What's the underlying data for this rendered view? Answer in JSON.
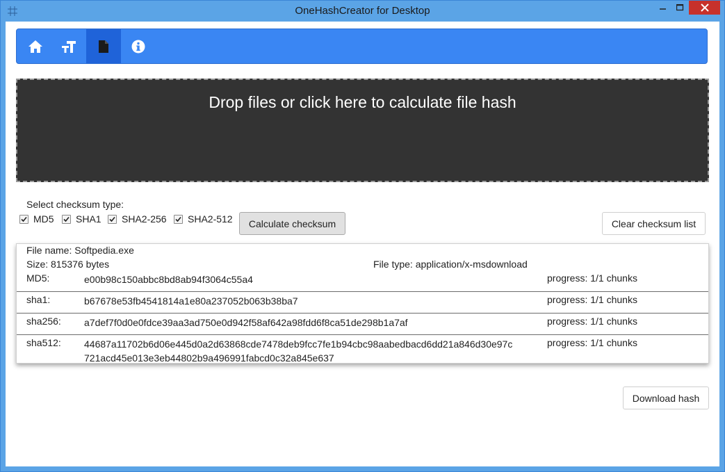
{
  "window": {
    "title": "OneHashCreator for Desktop",
    "icon": "app-grid-icon"
  },
  "nav": {
    "items": [
      {
        "name": "home",
        "icon": "home-icon"
      },
      {
        "name": "text-hash",
        "icon": "text-icon"
      },
      {
        "name": "file-hash",
        "icon": "file-icon",
        "active": true
      },
      {
        "name": "about",
        "icon": "info-icon"
      }
    ]
  },
  "dropzone": {
    "text": "Drop files or click here to calculate file hash"
  },
  "checksum": {
    "label": "Select checksum type:",
    "options": [
      {
        "label": "MD5",
        "checked": true
      },
      {
        "label": "SHA1",
        "checked": true
      },
      {
        "label": "SHA2-256",
        "checked": true
      },
      {
        "label": "SHA2-512",
        "checked": true
      }
    ],
    "calculate_label": "Calculate checksum",
    "clear_label": "Clear checksum list"
  },
  "result": {
    "file_name": "File name: Softpedia.exe",
    "size": "Size: 815376 bytes",
    "file_type": "File type: application/x-msdownload",
    "hashes": [
      {
        "label": "MD5:",
        "value": "e00b98c150abbc8bd8ab94f3064c55a4",
        "progress": "progress: 1/1 chunks"
      },
      {
        "label": "sha1:",
        "value": "b67678e53fb4541814a1e80a237052b063b38ba7",
        "progress": "progress: 1/1 chunks"
      },
      {
        "label": "sha256:",
        "value": "a7def7f0d0e0fdce39aa3ad750e0d942f58af642a98fdd6f8ca51de298b1a7af",
        "progress": "progress: 1/1 chunks"
      },
      {
        "label": "sha512:",
        "value_line1": "44687a11702b6d06e445d0a2d63868cde7478deb9fcc7fe1b94cbc98aabedbacd6dd21a846d30e97c",
        "value_line2": "721acd45e013e3eb44802b9a496991fabcd0c32a845e637",
        "progress": "progress: 1/1 chunks"
      }
    ]
  },
  "download_label": "Download hash",
  "colors": {
    "titlebar": "#5ba4e6",
    "navbar": "#3a86f3",
    "nav_active": "#1f63d9",
    "dropzone": "#333333",
    "close_button": "#c7312b"
  }
}
